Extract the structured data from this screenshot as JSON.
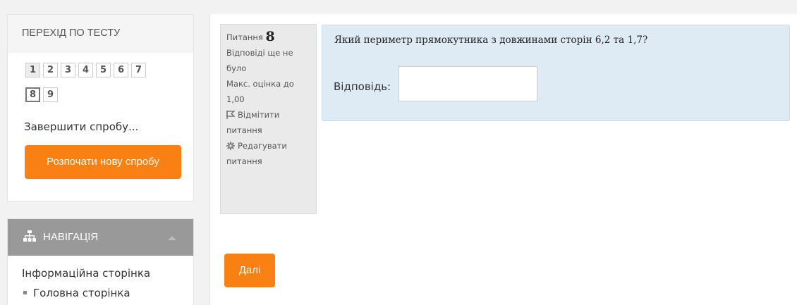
{
  "quiz_nav": {
    "title": "ПЕРЕХІД ПО ТЕСТУ",
    "questions": [
      "1",
      "2",
      "3",
      "4",
      "5",
      "6",
      "7",
      "8",
      "9"
    ],
    "current_question": "8",
    "finish_link": "Завершити спробу...",
    "new_attempt_button": "Розпочати нову спробу"
  },
  "navigation": {
    "title": "НАВІГАЦІЯ",
    "info_page": "Інформаційна сторінка",
    "home_page": "Головна сторінка"
  },
  "question_info": {
    "label": "Питання",
    "number": "8",
    "status": "Відповіді ще не було",
    "max_grade": "Макс. оцінка до 1,00",
    "flag_action": "Відмітити питання",
    "edit_action": "Редагувати питання"
  },
  "question": {
    "text": "Який периметр прямокутника з довжинами сторін 6,2 та 1,7?",
    "answer_label": "Відповідь:",
    "answer_value": ""
  },
  "next_button": "Далі",
  "colors": {
    "accent_orange": "#f98012",
    "question_bg": "#deeaf4",
    "nav_header_bg": "#999999"
  }
}
